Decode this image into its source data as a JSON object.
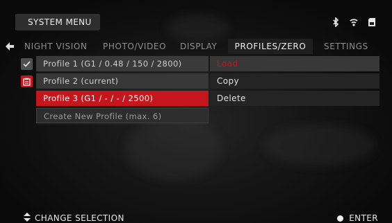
{
  "header": {
    "title": "SYSTEM MENU",
    "status_icons": [
      "bluetooth-icon",
      "wifi-icon",
      "sd-card-icon"
    ]
  },
  "tabs": [
    {
      "label": "NIGHT VISION",
      "active": false
    },
    {
      "label": "PHOTO/VIDEO",
      "active": false
    },
    {
      "label": "DISPLAY",
      "active": false
    },
    {
      "label": "PROFILES/ZERO",
      "active": true
    },
    {
      "label": "SETTINGS",
      "active": false
    }
  ],
  "profiles": [
    {
      "label": "Profile 1 (G1 / 0.48 / 150 / 2800)",
      "icon": "checkbox-icon"
    },
    {
      "label": "Profile 2 (current)",
      "icon": "clipboard-icon"
    },
    {
      "label": "Profile 3  (G1 / - / - / 2500)",
      "selected": true
    },
    {
      "label": "Create New Profile (max. 6)"
    }
  ],
  "context_menu": [
    "Load",
    "Copy",
    "Delete"
  ],
  "footer": {
    "left_label": "CHANGE SELECTION",
    "left_icon": "up-down-arrows-icon",
    "right_label": "ENTER",
    "right_icon": "enter-dot-icon"
  },
  "colors": {
    "accent": "#c4161c",
    "text": "#f0f0f0"
  }
}
